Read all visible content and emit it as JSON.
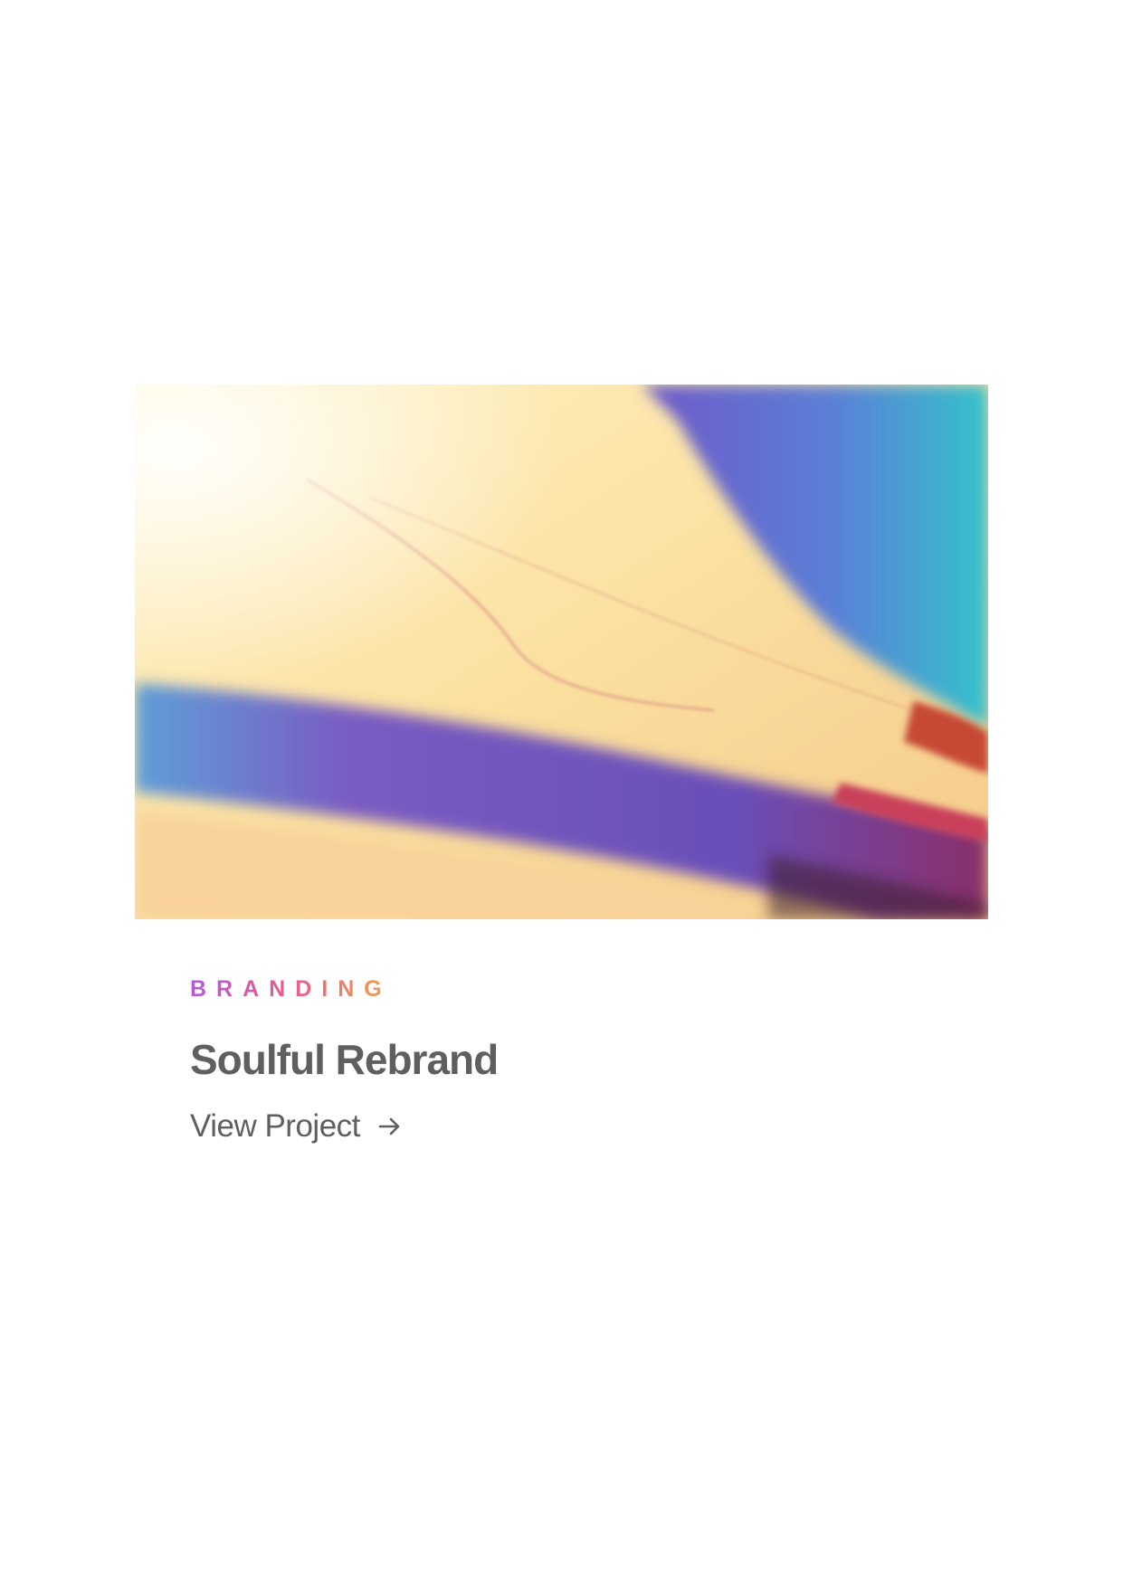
{
  "project_card": {
    "category": "BRANDING",
    "title": "Soulful Rebrand",
    "cta_label": "View Project",
    "cta_icon": "arrow-right-icon",
    "image": "abstract-gradient-image"
  },
  "colors": {
    "category_gradient": [
      "#b15bd6",
      "#e85c8a",
      "#f2a14a"
    ],
    "title": "#5f5f5f",
    "cta": "#5f5f5f",
    "background": "#ffffff"
  }
}
